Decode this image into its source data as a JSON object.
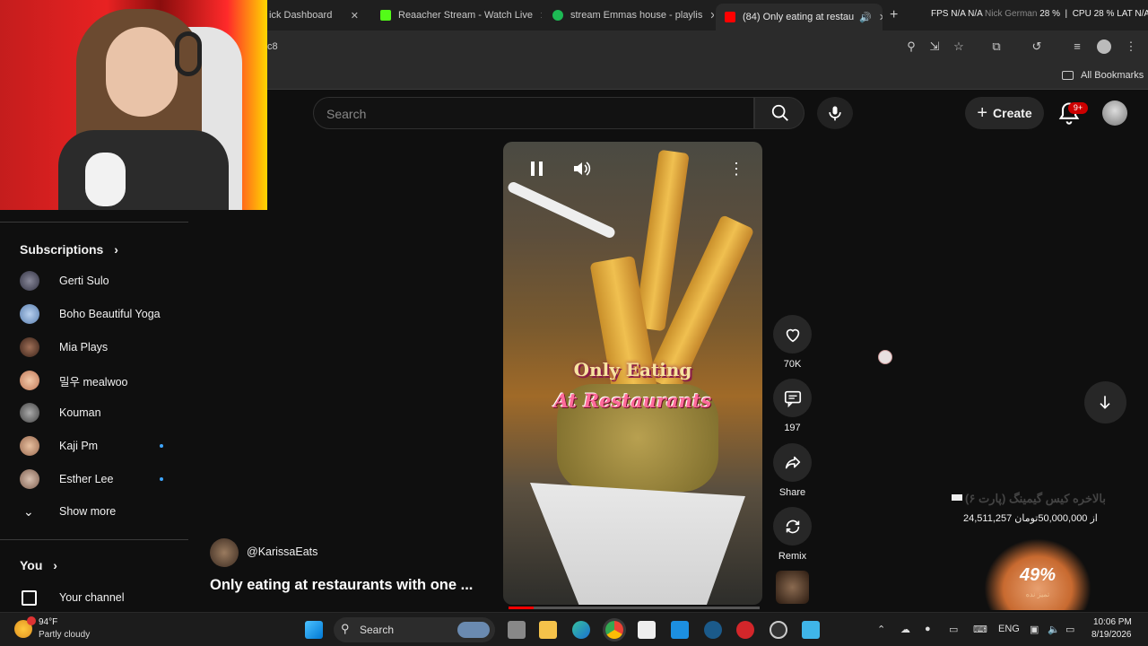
{
  "browser": {
    "tabs": [
      {
        "label": "ick Dashboard",
        "color": "#53fc18"
      },
      {
        "label": "Reaacher Stream - Watch Live",
        "color": "#53fc18"
      },
      {
        "label": "stream Emmas house - playlis",
        "color": "#1db954"
      },
      {
        "label": "(84) Only eating at restau",
        "color": "#ff0000",
        "active": true
      }
    ],
    "address": "c8",
    "bookmarks_label": "All Bookmarks"
  },
  "stats": {
    "fps": "FPS",
    "fps_val": "N/A",
    "gpu": "N/A",
    "note": "Nick German",
    "gpu_pct": "28 %",
    "cpu": "CPU",
    "cpu_pct": "28 %",
    "lat": "LAT",
    "lat_val": "N/A"
  },
  "header": {
    "search_placeholder": "Search",
    "create_label": "Create",
    "notif_badge": "9+"
  },
  "sidebar": {
    "subscriptions_label": "Subscriptions",
    "items": [
      {
        "label": "Gerti Sulo",
        "av": "#556",
        "dot": false
      },
      {
        "label": "Boho Beautiful Yoga",
        "av": "#7a9bc7",
        "dot": false
      },
      {
        "label": "Mia Plays",
        "av": "#6a4a3a",
        "dot": false
      },
      {
        "label": "밀우 mealwoo",
        "av": "#d9a07a",
        "dot": false
      },
      {
        "label": "Kouman",
        "av": "#4a4a4a",
        "dot": false
      },
      {
        "label": "Kaji Pm",
        "av": "#c9a080",
        "dot": true
      },
      {
        "label": "Esther Lee",
        "av": "#9a8070",
        "dot": true
      }
    ],
    "show_more": "Show more",
    "you_label": "You",
    "your_channel": "Your channel"
  },
  "video": {
    "caption_line1": "Only Eating",
    "caption_line2": "At Restaurants",
    "progress": 0.1
  },
  "actions": {
    "likes": "70K",
    "comments": "197",
    "share": "Share",
    "remix": "Remix"
  },
  "channel": {
    "handle": "@KarissaEats",
    "title": "Only eating at restaurants with one ..."
  },
  "donation": {
    "title": "بالاخره کیس گیمینگ (پارت ۶)",
    "amount": "24,511,257 از 50,000,000تومان",
    "percent": "49%",
    "sub": "تمیز نده"
  },
  "taskbar": {
    "weather_temp": "94°F",
    "weather_desc": "Partly cloudy",
    "search": "Search",
    "lang": "ENG",
    "time": "10:06 PM",
    "date": "8/19/2026"
  }
}
